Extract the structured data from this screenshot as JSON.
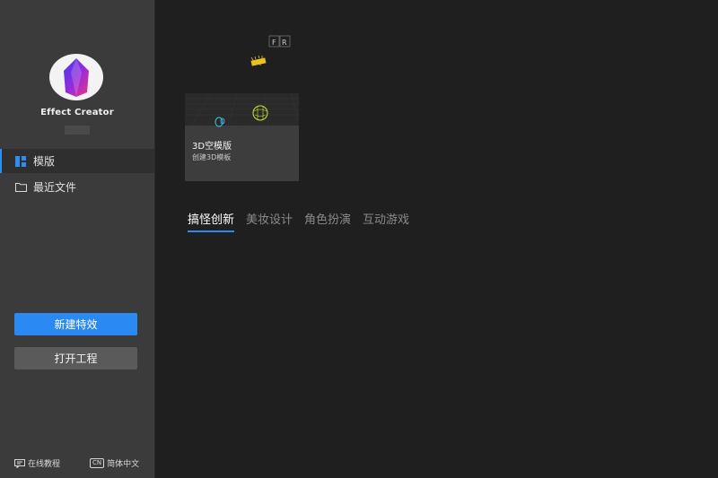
{
  "app": {
    "name": "Effect Creator"
  },
  "sidebar": {
    "items": [
      {
        "label": "模版",
        "icon": "template-grid-icon",
        "active": true
      },
      {
        "label": "最近文件",
        "icon": "folder-icon",
        "active": false
      }
    ],
    "new_effect_label": "新建特效",
    "open_project_label": "打开工程",
    "footer": {
      "tutorial_label": "在线教程",
      "language_badge": "CN",
      "language_label": "简体中文"
    }
  },
  "main": {
    "template_card": {
      "title": "3D空模版",
      "subtitle": "创建3D模板"
    },
    "scene_axes": {
      "front": "F",
      "right": "R"
    },
    "tabs": [
      {
        "label": "搞怪创新",
        "active": true
      },
      {
        "label": "美妆设计",
        "active": false
      },
      {
        "label": "角色扮演",
        "active": false
      },
      {
        "label": "互动游戏",
        "active": false
      }
    ]
  },
  "colors": {
    "accent": "#2b89f4",
    "sidebar_bg": "#3b3b3b",
    "main_bg": "#1f1f1f"
  }
}
